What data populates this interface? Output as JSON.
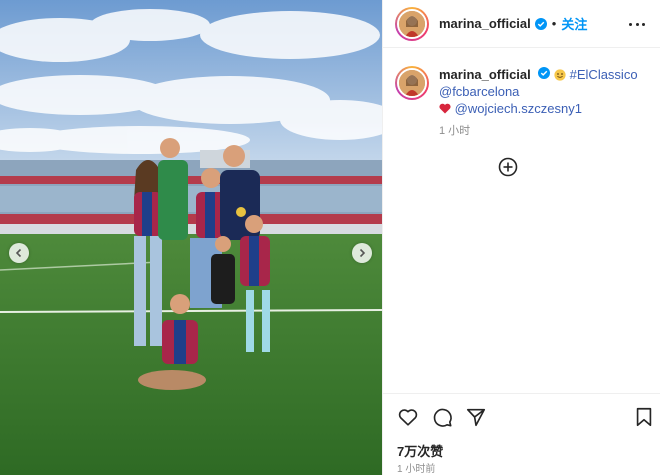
{
  "post": {
    "author": "marina_official",
    "follow_label": "关注",
    "separator": "•",
    "caption": {
      "username": "marina_official",
      "hashtag": "#ElClassico",
      "mention_1": "@fcbarcelona",
      "mention_2": "@wojciech.szczesny1",
      "time": "1 小时"
    },
    "likes": "7万次赞",
    "posted_time": "1 小时前"
  },
  "icons": {
    "verified": "verified-badge-icon",
    "more": "more-options-icon",
    "prev": "chevron-left-icon",
    "next": "chevron-right-icon",
    "load_comments": "plus-circle-icon",
    "like": "heart-icon",
    "comment": "comment-icon",
    "share": "paper-plane-icon",
    "save": "bookmark-icon",
    "emoji": "smiling-face-emoji-icon",
    "heart_emoji": "red-heart-emoji-icon"
  },
  "colors": {
    "link": "#3b5fb5",
    "follow": "#0095f6",
    "verified": "#0095f6",
    "muted": "#8e8e8e"
  }
}
